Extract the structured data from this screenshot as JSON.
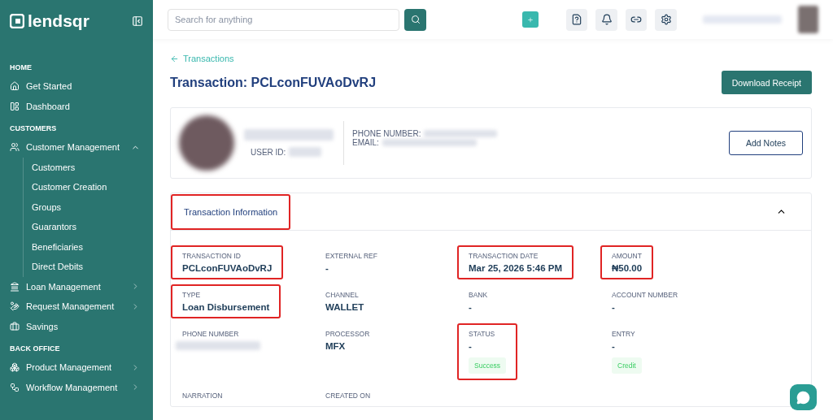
{
  "sidebar": {
    "logo": "lendsqr",
    "sections": [
      {
        "title": "HOME",
        "items": [
          {
            "label": "Get Started"
          },
          {
            "label": "Dashboard"
          }
        ]
      },
      {
        "title": "CUSTOMERS",
        "items": [
          {
            "label": "Customer Management",
            "expanded": true,
            "children": [
              {
                "label": "Customers"
              },
              {
                "label": "Customer Creation"
              },
              {
                "label": "Groups"
              },
              {
                "label": "Guarantors"
              },
              {
                "label": "Beneficiaries"
              },
              {
                "label": "Direct Debits"
              }
            ]
          },
          {
            "label": "Loan Management",
            "expanded": false
          },
          {
            "label": "Request Management",
            "expanded": false
          },
          {
            "label": "Savings"
          }
        ]
      },
      {
        "title": "BACK OFFICE",
        "items": [
          {
            "label": "Product Management",
            "expanded": false
          },
          {
            "label": "Workflow Management",
            "expanded": false
          }
        ]
      }
    ]
  },
  "header": {
    "search": {
      "placeholder": "Search for anything"
    }
  },
  "breadcrumb": "Transactions",
  "title": "Transaction: PCLconFUVAoDvRJ",
  "download_button": "Download Receipt",
  "customer_card": {
    "user_id_label": "USER ID:",
    "phone_label": "PHONE NUMBER:",
    "email_label": "EMAIL:",
    "add_notes_button": "Add Notes"
  },
  "section": {
    "title": "Transaction Information",
    "highlighted": true,
    "expanded": true,
    "fields": [
      {
        "label": "TRANSACTION ID",
        "value": "PCLconFUVAoDvRJ",
        "highlighted": true
      },
      {
        "label": "EXTERNAL REF",
        "value": "-",
        "highlighted": false
      },
      {
        "label": "TRANSACTION DATE",
        "value": "Mar 25, 2026 5:46 PM",
        "highlighted": true
      },
      {
        "label": "AMOUNT",
        "value": "₦50.00",
        "highlighted": true
      },
      {
        "label": "TYPE",
        "value": "Loan Disbursement",
        "highlighted": true
      },
      {
        "label": "CHANNEL",
        "value": "WALLET",
        "highlighted": false
      },
      {
        "label": "BANK",
        "value": "-",
        "highlighted": false
      },
      {
        "label": "ACCOUNT NUMBER",
        "value": "-",
        "highlighted": false
      },
      {
        "label": "PHONE NUMBER",
        "redacted": true,
        "highlighted": false
      },
      {
        "label": "PROCESSOR",
        "value": "MFX",
        "highlighted": false
      },
      {
        "label": "STATUS",
        "value": "-",
        "badge": "Success",
        "highlighted": true
      },
      {
        "label": "ENTRY",
        "value": "-",
        "badge": "Credit",
        "highlighted": false
      },
      {
        "label": "NARRATION",
        "highlighted": false
      },
      {
        "label": "CREATED ON",
        "highlighted": false
      }
    ]
  }
}
